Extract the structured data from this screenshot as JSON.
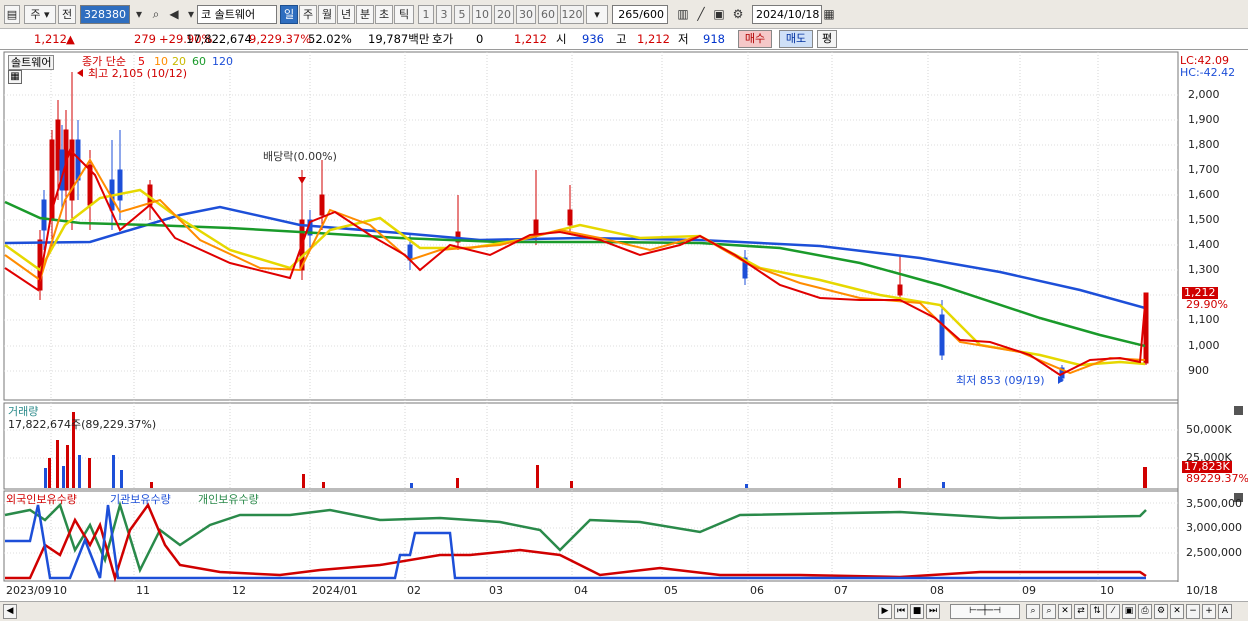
{
  "toolbar": {
    "market_type": "주",
    "prev_label": "전",
    "stock_code": "328380",
    "stock_name_prefix": "코",
    "stock_name": "솔트웨어",
    "periods": [
      "일",
      "주",
      "월",
      "년",
      "분",
      "초",
      "틱"
    ],
    "active_period": "일",
    "intervals": [
      "1",
      "3",
      "5",
      "10",
      "20",
      "30",
      "60",
      "120"
    ],
    "count": "265",
    "count_total": "/600",
    "date": "2024/10/18"
  },
  "quote": {
    "price": "1,212",
    "arrow": "▲",
    "change": "279",
    "change_pct": "+29.90%",
    "volume": "17,822,674",
    "volume_pct": "9,229.37%",
    "ratio": "52.02%",
    "amount": "19,787백만",
    "hoga_label": "호가",
    "hoga_value": "0",
    "hoga_price": "1,212",
    "open_label": "시",
    "open": "936",
    "high_label": "고",
    "high": "1,212",
    "low_label": "저",
    "low": "918",
    "buy_label": "매수",
    "sell_label": "매도",
    "eval_label": "평"
  },
  "price_panel": {
    "name_tag": "솔트웨어",
    "ma_title": "종가 단순",
    "ma_periods": [
      "5",
      "10",
      "20",
      "60",
      "120"
    ],
    "ma_colors": [
      "#e00000",
      "#ff8c00",
      "#e6d800",
      "#1a9a2a",
      "#1d4fd8"
    ],
    "high_note": "최고 2,105 (10/12)",
    "dividend_note": "배당락(0.00%)",
    "low_note": "최저 853 (09/19)",
    "lc": "LC:42.09",
    "hc": "HC:-42.42",
    "current_price_tag": "1,212",
    "current_pct_tag": "29.90%",
    "y_ticks": [
      "2,000",
      "1,900",
      "1,800",
      "1,700",
      "1,600",
      "1,500",
      "1,400",
      "1,300",
      "1,200",
      "1,100",
      "1,000",
      "900"
    ]
  },
  "volume_panel": {
    "title": "거래량",
    "value_label": "17,822,674주(89,229.37%)",
    "y_tick": "50,000K",
    "y_tick2": "25,000K",
    "current_tag": "17,823K",
    "current_pct": "89229.37%"
  },
  "holding_panel": {
    "legend": [
      "외국인보유수량",
      "기관보유수량",
      "개인보유수량"
    ],
    "legend_colors": [
      "#d00000",
      "#1d4fd8",
      "#2a8a4a"
    ],
    "y_ticks": [
      "3,500,000",
      "3,000,000",
      "2,500,000"
    ]
  },
  "x_axis": [
    "2023/09",
    "10",
    "11",
    "12",
    "2024/01",
    "02",
    "03",
    "04",
    "05",
    "06",
    "07",
    "08",
    "09",
    "10",
    "10/18"
  ]
}
